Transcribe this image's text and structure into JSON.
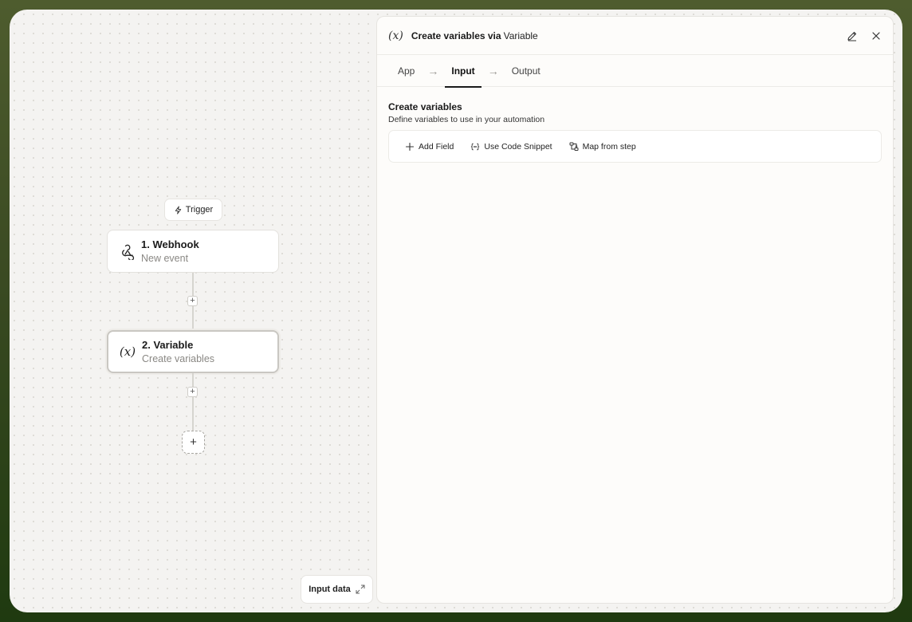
{
  "canvas": {
    "trigger_chip": "Trigger",
    "nodes": [
      {
        "title": "1. Webhook",
        "subtitle": "New event",
        "icon": "webhook-icon"
      },
      {
        "title": "2. Variable",
        "subtitle": "Create variables",
        "icon": "variable-icon"
      }
    ],
    "add_step_glyph": "+",
    "input_data_label": "Input data"
  },
  "panel": {
    "icon_glyph": "(x)",
    "title_prefix": "Create variables via",
    "title_app": "Variable",
    "tabs": [
      {
        "label": "App",
        "active": false
      },
      {
        "label": "Input",
        "active": true
      },
      {
        "label": "Output",
        "active": false
      }
    ],
    "section": {
      "title": "Create variables",
      "description": "Define variables to use in your automation"
    },
    "toolbar": {
      "add_field": "Add Field",
      "use_code_snippet": "Use Code Snippet",
      "map_from_step": "Map from step"
    }
  },
  "colors": {
    "frame_background": "#4e5c2e",
    "canvas_background": "#f4f3f1",
    "panel_background": "#fdfcfa"
  }
}
